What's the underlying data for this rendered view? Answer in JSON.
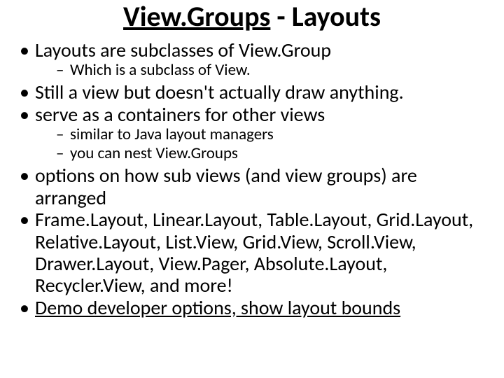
{
  "title": {
    "part1": "View.Groups",
    "part2": " - Layouts"
  },
  "bullets": {
    "b1": "Layouts are subclasses of View.Group",
    "b1_sub1": "Which is a subclass of View.",
    "b2": "Still a view but doesn't actually draw anything.",
    "b3": "serve as a containers for other views",
    "b3_sub1": "similar to Java layout managers",
    "b3_sub2": "you can nest View.Groups",
    "b4": "options on how sub views (and view groups) are arranged",
    "b5": "Frame.Layout, Linear.Layout, Table.Layout, Grid.Layout, Relative.Layout, List.View, Grid.View, Scroll.View, Drawer.Layout, View.Pager, Absolute.Layout, Recycler.View, and more!",
    "b6": "Demo developer options, show layout bounds"
  }
}
